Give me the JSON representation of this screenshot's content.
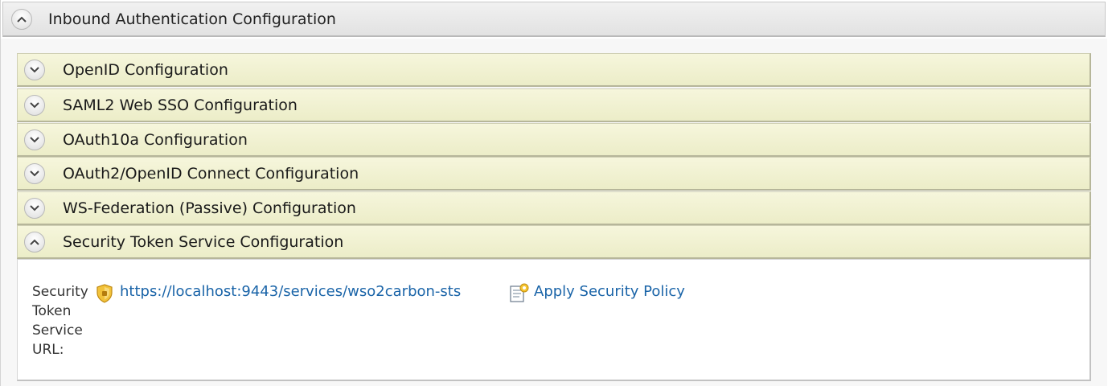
{
  "panel": {
    "title": "Inbound Authentication Configuration",
    "toggle_icon": "chevron-up-icon"
  },
  "sections": [
    {
      "label": "OpenID Configuration",
      "state": "collapsed"
    },
    {
      "label": "SAML2 Web SSO Configuration",
      "state": "collapsed"
    },
    {
      "label": "OAuth10a Configuration",
      "state": "collapsed"
    },
    {
      "label": "OAuth2/OpenID Connect Configuration",
      "state": "collapsed"
    },
    {
      "label": "WS-Federation (Passive) Configuration",
      "state": "collapsed"
    },
    {
      "label": "Security Token Service Configuration",
      "state": "expanded"
    }
  ],
  "sts": {
    "field_label": "Security Token Service URL:",
    "url": "https://localhost:9443/services/wso2carbon-sts",
    "apply_policy_label": "Apply Security Policy"
  },
  "colors": {
    "section_bg": "#eeefcf",
    "link": "#1a64a8",
    "header_bg": "#e8e8e8"
  }
}
